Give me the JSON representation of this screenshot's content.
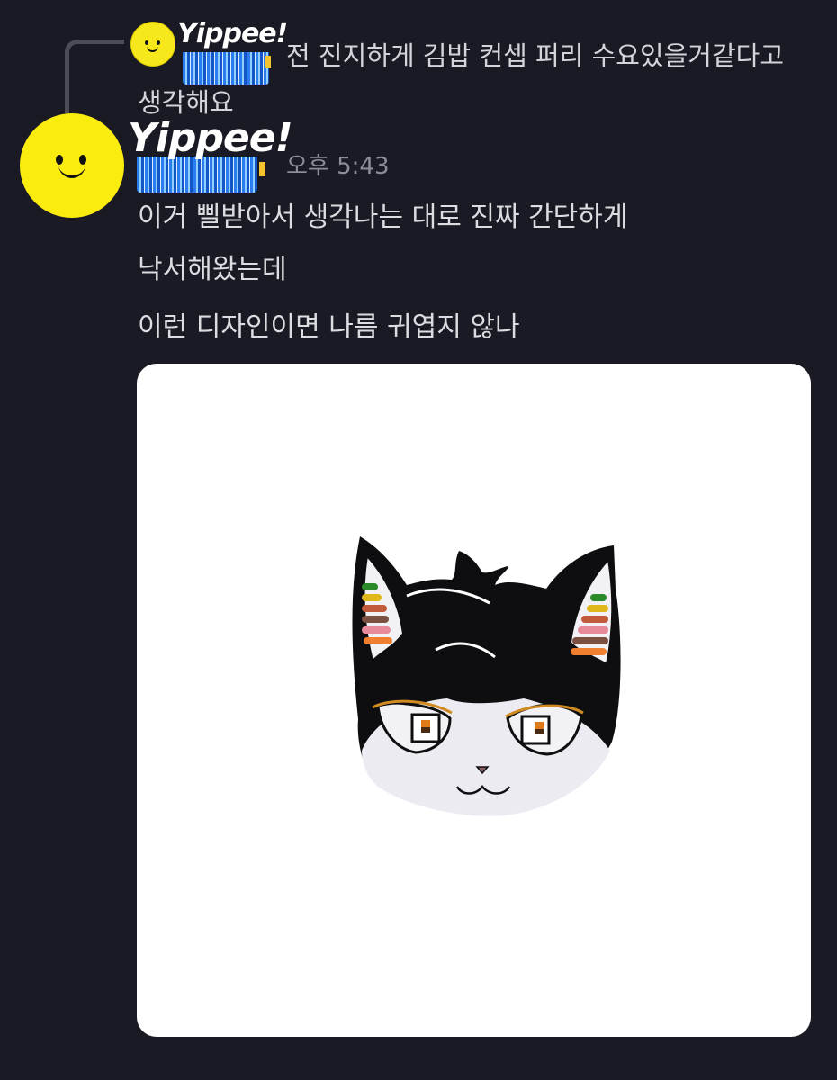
{
  "reply": {
    "author": "Yippee!",
    "text_line1": "전 진지하게 김밥 컨셉 퍼리 수요있을거같다고",
    "text_line2": "생각해요"
  },
  "message": {
    "author": "Yippee!",
    "timestamp": "오후 5:43",
    "lines": [
      "이거 삘받아서 생각나는 대로 진짜 간단하게",
      "낙서해왔는데",
      "이런 디자인이면 나름 귀엽지 않나"
    ]
  },
  "colors": {
    "background": "#1a1a24",
    "avatar": "#fbec10",
    "badge_blue": "#2a7cf0",
    "timestamp": "#8c8d96"
  },
  "icons": {
    "avatar": "smiley-face-avatar",
    "attachment": "black-cat-drawing"
  }
}
